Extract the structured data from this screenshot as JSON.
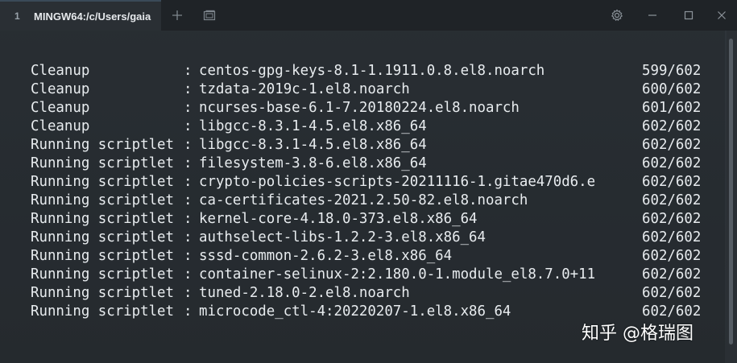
{
  "titlebar": {
    "tab_index": "1",
    "tab_title": "MINGW64:/c/Users/gaia"
  },
  "icons": {
    "plus": "plus-icon",
    "new_window": "new-window-icon",
    "settings": "gear-icon",
    "minimize": "minimize-icon",
    "maximize": "maximize-icon",
    "close": "close-icon"
  },
  "terminal": {
    "lines": [
      {
        "label": "Cleanup",
        "package": "centos-gpg-keys-8.1-1.1911.0.8.el8.noarch",
        "count": "599/602"
      },
      {
        "label": "Cleanup",
        "package": "tzdata-2019c-1.el8.noarch",
        "count": "600/602"
      },
      {
        "label": "Cleanup",
        "package": "ncurses-base-6.1-7.20180224.el8.noarch",
        "count": "601/602"
      },
      {
        "label": "Cleanup",
        "package": "libgcc-8.3.1-4.5.el8.x86_64",
        "count": "602/602"
      },
      {
        "label": "Running scriptlet",
        "package": "libgcc-8.3.1-4.5.el8.x86_64",
        "count": "602/602"
      },
      {
        "label": "Running scriptlet",
        "package": "filesystem-3.8-6.el8.x86_64",
        "count": "602/602"
      },
      {
        "label": "Running scriptlet",
        "package": "crypto-policies-scripts-20211116-1.gitae470d6.e",
        "count": "602/602"
      },
      {
        "label": "Running scriptlet",
        "package": "ca-certificates-2021.2.50-82.el8.noarch",
        "count": "602/602"
      },
      {
        "label": "Running scriptlet",
        "package": "kernel-core-4.18.0-373.el8.x86_64",
        "count": "602/602"
      },
      {
        "label": "Running scriptlet",
        "package": "authselect-libs-1.2.2-3.el8.x86_64",
        "count": "602/602"
      },
      {
        "label": "Running scriptlet",
        "package": "sssd-common-2.6.2-3.el8.x86_64",
        "count": "602/602"
      },
      {
        "label": "Running scriptlet",
        "package": "container-selinux-2:2.180.0-1.module_el8.7.0+11",
        "count": "602/602"
      },
      {
        "label": "Running scriptlet",
        "package": "tuned-2.18.0-2.el8.noarch",
        "count": "602/602"
      },
      {
        "label": "Running scriptlet",
        "package": "microcode_ctl-4:20220207-1.el8.x86_64",
        "count": "602/602"
      }
    ]
  },
  "watermark": "知乎 @格瑞图",
  "colors": {
    "background": "#2b3035",
    "titlebar": "#1f2327",
    "text": "#e8ecef"
  }
}
